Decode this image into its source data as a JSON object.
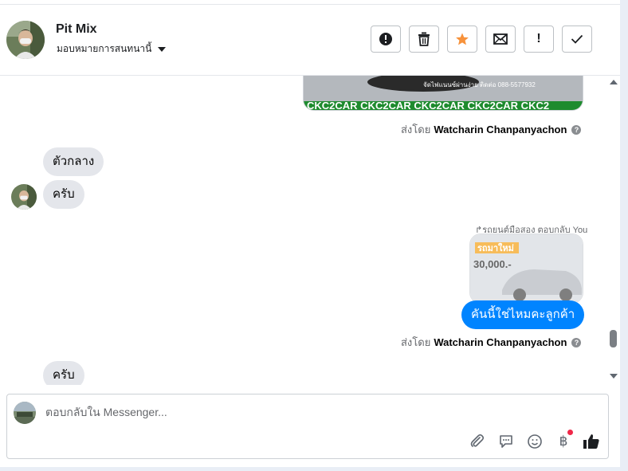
{
  "header": {
    "name": "Pit Mix",
    "assign_label": "มอบหมายการสนทนานี้",
    "actions": [
      {
        "name": "spam-button",
        "icon": "alert-circle-icon"
      },
      {
        "name": "delete-button",
        "icon": "trash-icon"
      },
      {
        "name": "star-button",
        "icon": "star-icon",
        "color": "#f7923b"
      },
      {
        "name": "mark-unread-button",
        "icon": "envelope-icon"
      },
      {
        "name": "follow-up-button",
        "icon": "exclamation-icon",
        "label": "!"
      },
      {
        "name": "done-button",
        "icon": "check-icon"
      }
    ]
  },
  "conversation": {
    "top_image_banner": "CKC2CAR CKC2CAR CKC2CAR CKC2CAR CKC2",
    "sent_by_prefix": "ส่งโดย",
    "sent_by_1": "Watcharin Chanpanyachon",
    "msg_in_1": "ตัวกลาง",
    "msg_in_2": "ครับ",
    "reply_label": "รถยนต์มือสอง ตอบกลับ You",
    "reply_image_price": "30,000.-",
    "reply_image_title": "รถมาใหม่",
    "msg_out_1": "คันนี้ใช่ไหมคะลูกค้า",
    "sent_by_2": "Watcharin Chanpanyachon",
    "msg_in_3": "ครับ",
    "help_glyph": "?"
  },
  "composer": {
    "placeholder": "ตอบกลับใน Messenger...",
    "value": "",
    "baht_glyph": "฿"
  },
  "colors": {
    "accent": "#0084ff",
    "bubble_in": "#e4e6eb",
    "star": "#f7923b",
    "notification_dot": "#f02849"
  }
}
